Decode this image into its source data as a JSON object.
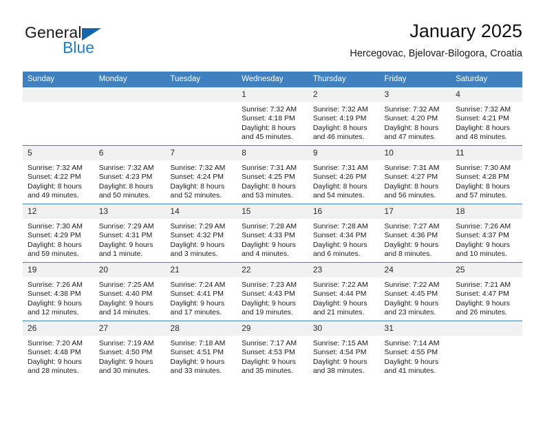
{
  "brand": {
    "name_top": "General",
    "name_bottom": "Blue",
    "color_dark": "#1a1a1a",
    "color_blue": "#1f7fc4",
    "triangle_color": "#1565a8"
  },
  "header": {
    "title": "January 2025",
    "subtitle": "Hercegovac, Bjelovar-Bilogora, Croatia"
  },
  "theme": {
    "header_row_bg": "#3f80c0",
    "header_row_text": "#ffffff",
    "daynum_bg": "#f1f1f1",
    "grid_line": "#3f80c0"
  },
  "weekdays": [
    "Sunday",
    "Monday",
    "Tuesday",
    "Wednesday",
    "Thursday",
    "Friday",
    "Saturday"
  ],
  "weeks": [
    [
      {
        "day": "",
        "sunrise": "",
        "sunset": "",
        "daylight_line1": "",
        "daylight_line2": "",
        "empty": true
      },
      {
        "day": "",
        "sunrise": "",
        "sunset": "",
        "daylight_line1": "",
        "daylight_line2": "",
        "empty": true
      },
      {
        "day": "",
        "sunrise": "",
        "sunset": "",
        "daylight_line1": "",
        "daylight_line2": "",
        "empty": true
      },
      {
        "day": "1",
        "sunrise": "Sunrise: 7:32 AM",
        "sunset": "Sunset: 4:18 PM",
        "daylight_line1": "Daylight: 8 hours",
        "daylight_line2": "and 45 minutes.",
        "empty": false
      },
      {
        "day": "2",
        "sunrise": "Sunrise: 7:32 AM",
        "sunset": "Sunset: 4:19 PM",
        "daylight_line1": "Daylight: 8 hours",
        "daylight_line2": "and 46 minutes.",
        "empty": false
      },
      {
        "day": "3",
        "sunrise": "Sunrise: 7:32 AM",
        "sunset": "Sunset: 4:20 PM",
        "daylight_line1": "Daylight: 8 hours",
        "daylight_line2": "and 47 minutes.",
        "empty": false
      },
      {
        "day": "4",
        "sunrise": "Sunrise: 7:32 AM",
        "sunset": "Sunset: 4:21 PM",
        "daylight_line1": "Daylight: 8 hours",
        "daylight_line2": "and 48 minutes.",
        "empty": false
      }
    ],
    [
      {
        "day": "5",
        "sunrise": "Sunrise: 7:32 AM",
        "sunset": "Sunset: 4:22 PM",
        "daylight_line1": "Daylight: 8 hours",
        "daylight_line2": "and 49 minutes.",
        "empty": false
      },
      {
        "day": "6",
        "sunrise": "Sunrise: 7:32 AM",
        "sunset": "Sunset: 4:23 PM",
        "daylight_line1": "Daylight: 8 hours",
        "daylight_line2": "and 50 minutes.",
        "empty": false
      },
      {
        "day": "7",
        "sunrise": "Sunrise: 7:32 AM",
        "sunset": "Sunset: 4:24 PM",
        "daylight_line1": "Daylight: 8 hours",
        "daylight_line2": "and 52 minutes.",
        "empty": false
      },
      {
        "day": "8",
        "sunrise": "Sunrise: 7:31 AM",
        "sunset": "Sunset: 4:25 PM",
        "daylight_line1": "Daylight: 8 hours",
        "daylight_line2": "and 53 minutes.",
        "empty": false
      },
      {
        "day": "9",
        "sunrise": "Sunrise: 7:31 AM",
        "sunset": "Sunset: 4:26 PM",
        "daylight_line1": "Daylight: 8 hours",
        "daylight_line2": "and 54 minutes.",
        "empty": false
      },
      {
        "day": "10",
        "sunrise": "Sunrise: 7:31 AM",
        "sunset": "Sunset: 4:27 PM",
        "daylight_line1": "Daylight: 8 hours",
        "daylight_line2": "and 56 minutes.",
        "empty": false
      },
      {
        "day": "11",
        "sunrise": "Sunrise: 7:30 AM",
        "sunset": "Sunset: 4:28 PM",
        "daylight_line1": "Daylight: 8 hours",
        "daylight_line2": "and 57 minutes.",
        "empty": false
      }
    ],
    [
      {
        "day": "12",
        "sunrise": "Sunrise: 7:30 AM",
        "sunset": "Sunset: 4:29 PM",
        "daylight_line1": "Daylight: 8 hours",
        "daylight_line2": "and 59 minutes.",
        "empty": false
      },
      {
        "day": "13",
        "sunrise": "Sunrise: 7:29 AM",
        "sunset": "Sunset: 4:31 PM",
        "daylight_line1": "Daylight: 9 hours",
        "daylight_line2": "and 1 minute.",
        "empty": false
      },
      {
        "day": "14",
        "sunrise": "Sunrise: 7:29 AM",
        "sunset": "Sunset: 4:32 PM",
        "daylight_line1": "Daylight: 9 hours",
        "daylight_line2": "and 3 minutes.",
        "empty": false
      },
      {
        "day": "15",
        "sunrise": "Sunrise: 7:28 AM",
        "sunset": "Sunset: 4:33 PM",
        "daylight_line1": "Daylight: 9 hours",
        "daylight_line2": "and 4 minutes.",
        "empty": false
      },
      {
        "day": "16",
        "sunrise": "Sunrise: 7:28 AM",
        "sunset": "Sunset: 4:34 PM",
        "daylight_line1": "Daylight: 9 hours",
        "daylight_line2": "and 6 minutes.",
        "empty": false
      },
      {
        "day": "17",
        "sunrise": "Sunrise: 7:27 AM",
        "sunset": "Sunset: 4:36 PM",
        "daylight_line1": "Daylight: 9 hours",
        "daylight_line2": "and 8 minutes.",
        "empty": false
      },
      {
        "day": "18",
        "sunrise": "Sunrise: 7:26 AM",
        "sunset": "Sunset: 4:37 PM",
        "daylight_line1": "Daylight: 9 hours",
        "daylight_line2": "and 10 minutes.",
        "empty": false
      }
    ],
    [
      {
        "day": "19",
        "sunrise": "Sunrise: 7:26 AM",
        "sunset": "Sunset: 4:38 PM",
        "daylight_line1": "Daylight: 9 hours",
        "daylight_line2": "and 12 minutes.",
        "empty": false
      },
      {
        "day": "20",
        "sunrise": "Sunrise: 7:25 AM",
        "sunset": "Sunset: 4:40 PM",
        "daylight_line1": "Daylight: 9 hours",
        "daylight_line2": "and 14 minutes.",
        "empty": false
      },
      {
        "day": "21",
        "sunrise": "Sunrise: 7:24 AM",
        "sunset": "Sunset: 4:41 PM",
        "daylight_line1": "Daylight: 9 hours",
        "daylight_line2": "and 17 minutes.",
        "empty": false
      },
      {
        "day": "22",
        "sunrise": "Sunrise: 7:23 AM",
        "sunset": "Sunset: 4:43 PM",
        "daylight_line1": "Daylight: 9 hours",
        "daylight_line2": "and 19 minutes.",
        "empty": false
      },
      {
        "day": "23",
        "sunrise": "Sunrise: 7:22 AM",
        "sunset": "Sunset: 4:44 PM",
        "daylight_line1": "Daylight: 9 hours",
        "daylight_line2": "and 21 minutes.",
        "empty": false
      },
      {
        "day": "24",
        "sunrise": "Sunrise: 7:22 AM",
        "sunset": "Sunset: 4:45 PM",
        "daylight_line1": "Daylight: 9 hours",
        "daylight_line2": "and 23 minutes.",
        "empty": false
      },
      {
        "day": "25",
        "sunrise": "Sunrise: 7:21 AM",
        "sunset": "Sunset: 4:47 PM",
        "daylight_line1": "Daylight: 9 hours",
        "daylight_line2": "and 26 minutes.",
        "empty": false
      }
    ],
    [
      {
        "day": "26",
        "sunrise": "Sunrise: 7:20 AM",
        "sunset": "Sunset: 4:48 PM",
        "daylight_line1": "Daylight: 9 hours",
        "daylight_line2": "and 28 minutes.",
        "empty": false
      },
      {
        "day": "27",
        "sunrise": "Sunrise: 7:19 AM",
        "sunset": "Sunset: 4:50 PM",
        "daylight_line1": "Daylight: 9 hours",
        "daylight_line2": "and 30 minutes.",
        "empty": false
      },
      {
        "day": "28",
        "sunrise": "Sunrise: 7:18 AM",
        "sunset": "Sunset: 4:51 PM",
        "daylight_line1": "Daylight: 9 hours",
        "daylight_line2": "and 33 minutes.",
        "empty": false
      },
      {
        "day": "29",
        "sunrise": "Sunrise: 7:17 AM",
        "sunset": "Sunset: 4:53 PM",
        "daylight_line1": "Daylight: 9 hours",
        "daylight_line2": "and 35 minutes.",
        "empty": false
      },
      {
        "day": "30",
        "sunrise": "Sunrise: 7:15 AM",
        "sunset": "Sunset: 4:54 PM",
        "daylight_line1": "Daylight: 9 hours",
        "daylight_line2": "and 38 minutes.",
        "empty": false
      },
      {
        "day": "31",
        "sunrise": "Sunrise: 7:14 AM",
        "sunset": "Sunset: 4:55 PM",
        "daylight_line1": "Daylight: 9 hours",
        "daylight_line2": "and 41 minutes.",
        "empty": false
      },
      {
        "day": "",
        "sunrise": "",
        "sunset": "",
        "daylight_line1": "",
        "daylight_line2": "",
        "empty": true
      }
    ]
  ]
}
